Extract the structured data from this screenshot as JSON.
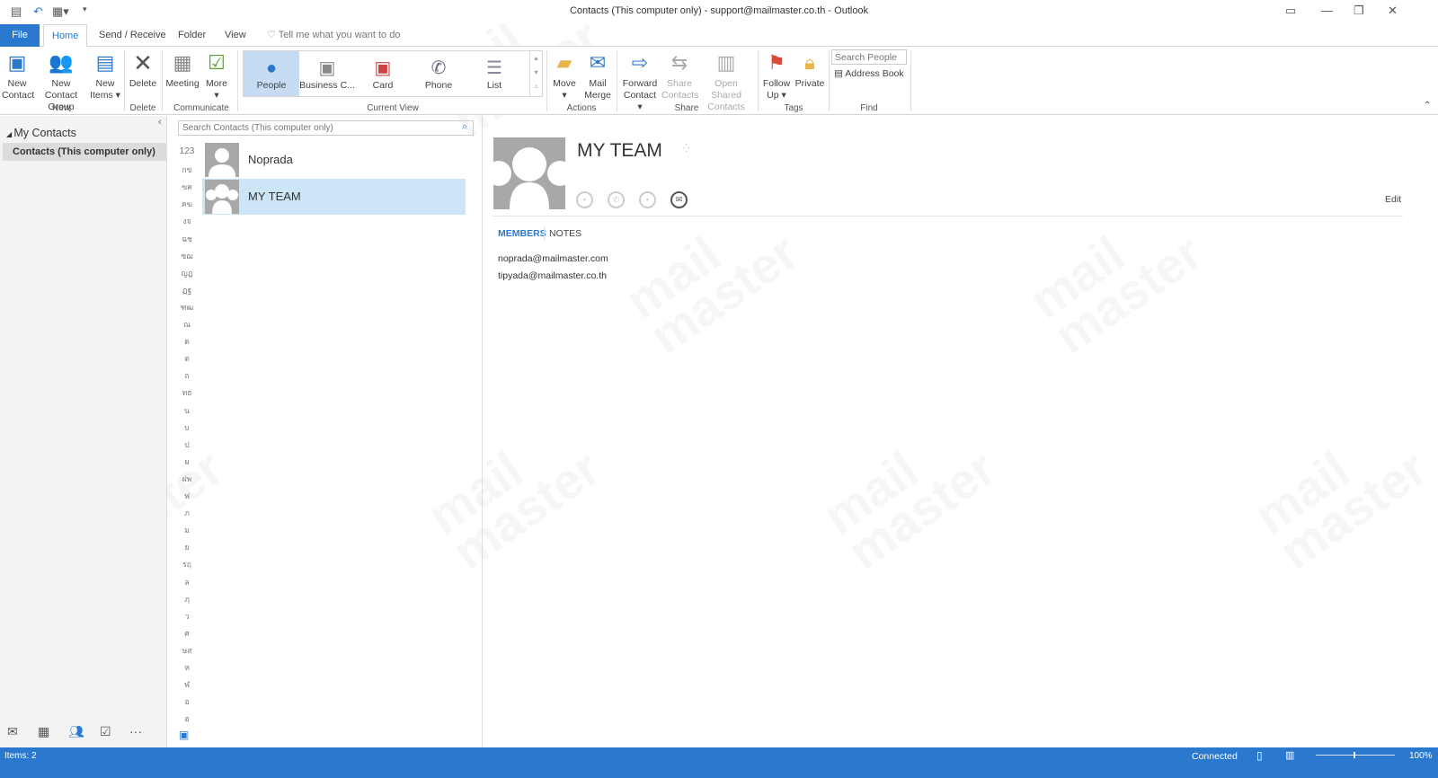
{
  "window": {
    "title": "Contacts (This computer only) - support@mailmaster.co.th  -  Outlook"
  },
  "tabs": {
    "file": "File",
    "home": "Home",
    "send_receive": "Send / Receive",
    "folder": "Folder",
    "view": "View",
    "tell_me": "Tell me what you want to do"
  },
  "ribbon": {
    "new_contact": "New Contact",
    "new_contact_group": "New Contact Group",
    "new_items": "New Items",
    "delete": "Delete",
    "meeting": "Meeting",
    "more": "More",
    "views": [
      "People",
      "Business C...",
      "Card",
      "Phone",
      "List"
    ],
    "move": "Move",
    "mail_merge": "Mail Merge",
    "forward_contact": "Forward Contact",
    "share_contacts": "Share Contacts",
    "open_shared_contacts": "Open Shared Contacts",
    "follow_up": "Follow Up",
    "private": "Private",
    "search_people_placeholder": "Search People",
    "address_book": "Address Book",
    "groups": {
      "new": "New",
      "delete": "Delete",
      "communicate": "Communicate",
      "current_view": "Current View",
      "actions": "Actions",
      "share": "Share",
      "tags": "Tags",
      "find": "Find"
    }
  },
  "nav": {
    "section": "My Contacts",
    "folder": "Contacts (This computer only)"
  },
  "list": {
    "search_placeholder": "Search Contacts (This computer only)",
    "index": [
      "123",
      "กข",
      "ฃค",
      "ฅฆ",
      "งจ",
      "ฉช",
      "ซฌ",
      "ญฎ",
      "ฏฐ",
      "ฑฒ",
      "ณ",
      "ด",
      "ต",
      "ถ",
      "ทธ",
      "น",
      "บ",
      "ป",
      "ผ",
      "ฝพ",
      "ฟ",
      "ภ",
      "ม",
      "ย",
      "รฤ",
      "ล",
      "ฦ",
      "ว",
      "ศ",
      "ษส",
      "ห",
      "ฬ",
      "อ",
      "ฮ"
    ],
    "contacts": [
      {
        "name": "Noprada"
      },
      {
        "name": "MY TEAM"
      }
    ]
  },
  "detail": {
    "name": "MY TEAM",
    "edit": "Edit",
    "tab_members": "MEMBERS",
    "tab_notes": "NOTES",
    "members": [
      "noprada@mailmaster.com",
      "tipyada@mailmaster.co.th"
    ]
  },
  "status": {
    "items": "Items: 2",
    "connection": "Connected",
    "zoom": "100%"
  },
  "watermark": "mail master",
  "colors": {
    "accent": "#2b79cf",
    "selected": "#cde6f7"
  }
}
